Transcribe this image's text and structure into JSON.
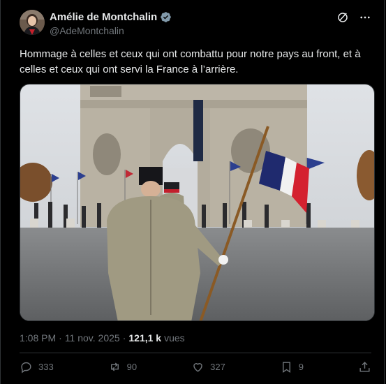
{
  "author": {
    "name": "Amélie de Montchalin",
    "handle": "@AdeMontchalin",
    "verified": true
  },
  "tweet": {
    "text": "Hommage à celles et ceux qui ont combattu pour notre pays au front, et à celles et ceux qui ont servi la France à l’arrière."
  },
  "meta": {
    "time": "1:08 PM",
    "separator1": "·",
    "date": "11 nov. 2025",
    "separator2": "·",
    "views_count": "121,1 k",
    "views_label": "vues"
  },
  "actions": {
    "replies": "333",
    "reposts": "90",
    "likes": "327",
    "bookmarks": "9"
  },
  "colors": {
    "background": "#000000",
    "text": "#e7e9ea",
    "muted": "#71767b",
    "verified_badge": "#829aab",
    "border": "#2f3336"
  },
  "icons": [
    "grok-icon",
    "more-icon",
    "reply-icon",
    "repost-icon",
    "like-icon",
    "bookmark-icon",
    "share-icon"
  ]
}
